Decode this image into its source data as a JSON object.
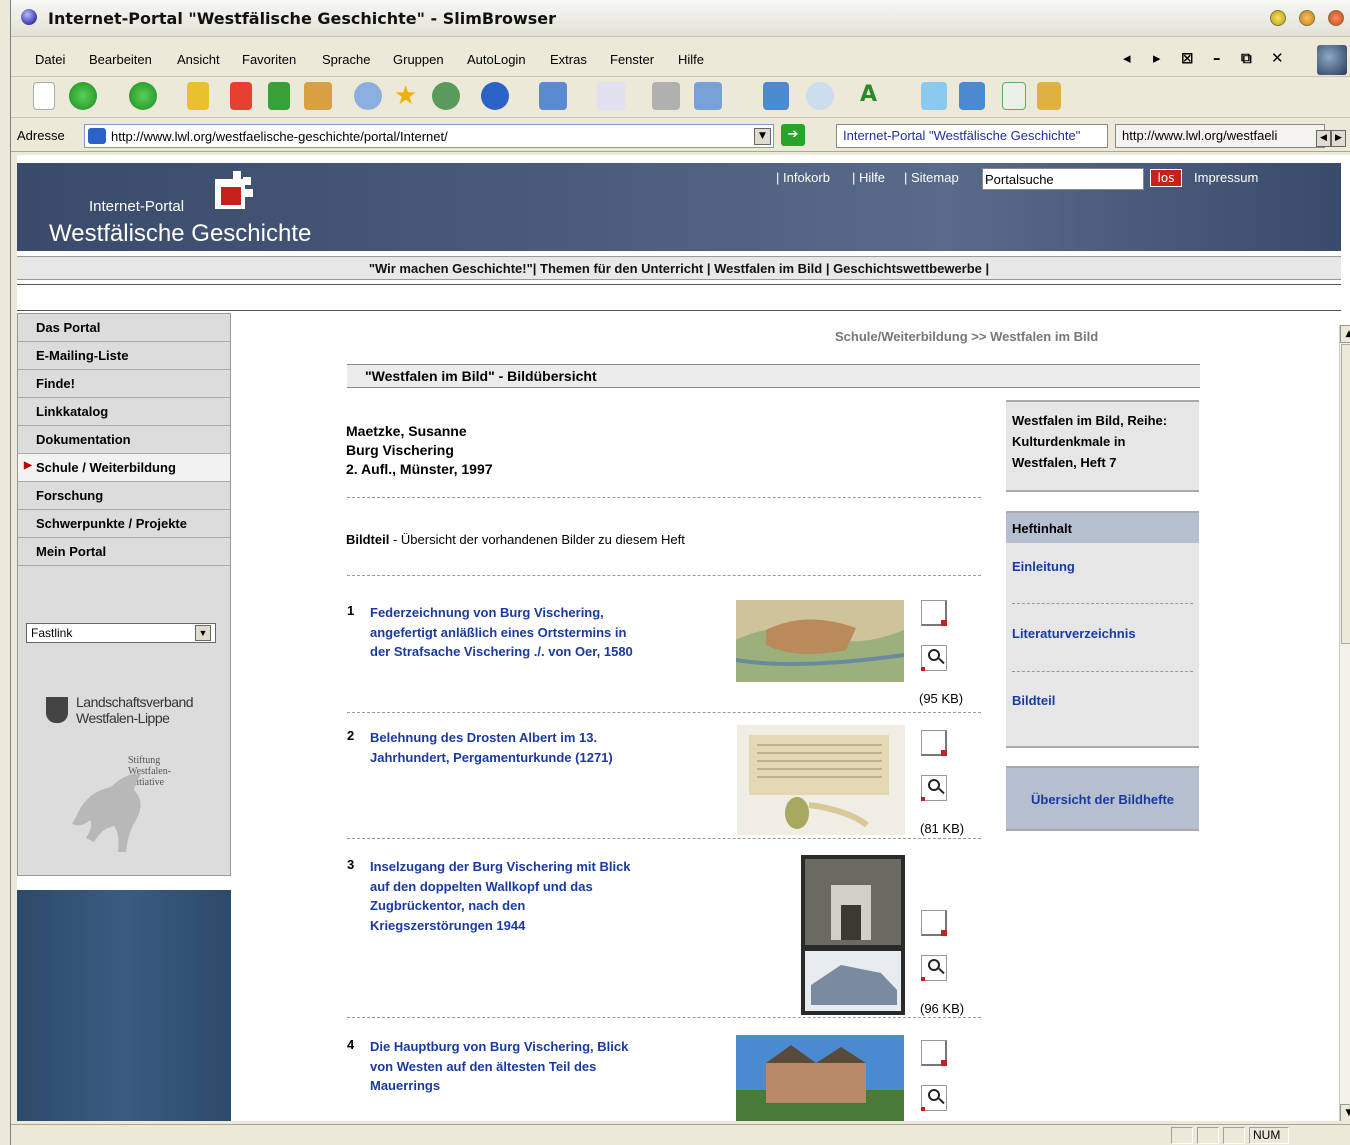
{
  "window": {
    "title": "Internet-Portal \"Westfälische Geschichte\" - SlimBrowser"
  },
  "menu": [
    "Datei",
    "Bearbeiten",
    "Ansicht",
    "Favoriten",
    "Sprache",
    "Gruppen",
    "AutoLogin",
    "Extras",
    "Fenster",
    "Hilfe"
  ],
  "address": {
    "label": "Adresse",
    "url": "http://www.lwl.org/westfaelische-geschichte/portal/Internet/"
  },
  "tabs": [
    {
      "label": "Internet-Portal \"Westfälische Geschichte\""
    },
    {
      "label": "http://www.lwl.org/westfaeli"
    }
  ],
  "banner": {
    "small": "Internet-Portal",
    "large": "Westfälische Geschichte"
  },
  "topnav": {
    "infokorb": "Infokorb",
    "hilfe": "Hilfe",
    "sitemap": "Sitemap",
    "search_value": "Portalsuche",
    "go": "los",
    "impressum": "Impressum"
  },
  "subnav": "\"Wir machen Geschichte!\"| Themen für den Unterricht | Westfalen im Bild | Geschichtswettbewerbe |",
  "sidebar": {
    "items": [
      "Das Portal",
      "E-Mailing-Liste",
      "Finde!",
      "Linkkatalog",
      "Dokumentation",
      "Schule / Weiterbildung",
      "Forschung",
      "Schwerpunkte / Projekte",
      "Mein Portal"
    ],
    "fastlink": "Fastlink",
    "lwl_line1": "Landschaftsverband",
    "lwl_line2": "Westfalen-Lippe",
    "stiftung1": "Stiftung",
    "stiftung2": "Westfalen-",
    "stiftung3": "Initiative"
  },
  "breadcrumb": "Schule/Weiterbildung >> Westfalen im Bild",
  "section_title": "\"Westfalen im Bild\" - Bildübersicht",
  "book": {
    "author": "Maetzke, Susanne",
    "title": "Burg Vischering",
    "edition": "2. Aufl., Münster, 1997"
  },
  "bildteil": {
    "bold": "Bildteil",
    "rest": " - Übersicht der vorhandenen Bilder zu diesem Heft"
  },
  "entries": [
    {
      "num": "1",
      "title": "Federzeichnung von Burg Vischering, angefertigt anläßlich eines Ortstermins in der Strafsache Vischering ./. von Oer, 1580",
      "size": "(95 KB)"
    },
    {
      "num": "2",
      "title": "Belehnung des Drosten Albert im 13. Jahrhundert, Pergamenturkunde (1271)",
      "size": "(81 KB)"
    },
    {
      "num": "3",
      "title": "Inselzugang der Burg Vischering mit Blick auf den doppelten Wallkopf und das Zugbrückentor, nach den Kriegszerstörungen 1944",
      "size": "(96 KB)"
    },
    {
      "num": "4",
      "title": "Die Hauptburg von Burg Vischering, Blick von Westen auf den ältesten Teil des Mauerrings",
      "size": ""
    }
  ],
  "right": {
    "series": "Westfalen im Bild, Reihe: Kulturdenkmale in Westfalen, Heft 7",
    "heftinhalt": "Heftinhalt",
    "links": [
      "Einleitung",
      "Literaturverzeichnis",
      "Bildteil"
    ],
    "overview": "Übersicht der Bildhefte"
  },
  "status": {
    "num": "NUM"
  }
}
